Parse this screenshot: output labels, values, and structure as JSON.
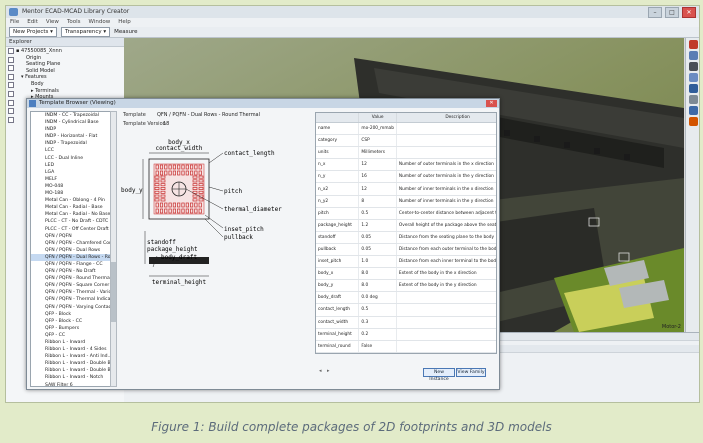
{
  "app": {
    "title": "Mentor ECAD-MCAD Library Creator",
    "menus": [
      "File",
      "Edit",
      "View",
      "Tools",
      "Window",
      "Help"
    ],
    "window_buttons": {
      "min": "–",
      "max": "□",
      "close": "✕"
    }
  },
  "toolbar": {
    "new_projects": "New Projects ▾",
    "transparency": "Transparency ▾",
    "measure": "Measure"
  },
  "explorer": {
    "header": "Explorer",
    "items": [
      {
        "label": "▪ 47550085_Xnnn",
        "indent": 0
      },
      {
        "label": "Origin",
        "indent": 2
      },
      {
        "label": "Seating Plane",
        "indent": 2
      },
      {
        "label": "Solid Model",
        "indent": 2
      },
      {
        "label": "▾ Features",
        "indent": 1
      },
      {
        "label": "Body",
        "indent": 3
      },
      {
        "label": "▸ Terminals",
        "indent": 3
      },
      {
        "label": "▸ Mounts",
        "indent": 3
      },
      {
        "label": "Other",
        "indent": 3
      }
    ]
  },
  "viewport": {
    "corner_label": "Motor-2"
  },
  "dialog": {
    "title": "Template Browser (Viewing)",
    "template_label": "Template",
    "template_value": "QFN / PQFN - Dual Rows - Round Thermal",
    "version_label": "Template Version",
    "version_value": "18",
    "list": [
      "INDM - CC - Trapezoidal",
      "INDM - Cylindrical Base",
      "INDP",
      "INDP - Horizontal - Flat",
      "INDP - Trapezoidal",
      "LCC",
      "LCC - Dual Inline",
      "LED",
      "LGA",
      "MELF",
      "MO-048",
      "MO-188",
      "Metal Can - Oblong - 4 Pin",
      "Metal Can - Radial - Base",
      "Metal Can - Radial - No Base",
      "PLCC - CT - No Draft - CDTC",
      "PLCC - CT - Off Center Draft",
      "QFN / PQFN",
      "QFN / PQFN - Chamfered Cor...",
      "QFN / PQFN - Dual Rows",
      "QFN / PQFN - Dual Rows - Ro...",
      "QFN / PQFN - Flange - CC",
      "QFN / PQFN - No Draft",
      "QFN / PQFN - Round Thermal",
      "QFN / PQFN - Square Corner T...",
      "QFN / PQFN - Thermal - Vario...",
      "QFN / PQFN - Thermal Indicator",
      "QFN / PQFN - Varying Contac...",
      "QFP - Block",
      "QFP - Block - CC",
      "QFP - Bumpers",
      "QFP - CC",
      "Ribbon L - Inward",
      "Ribbon L - Inward - 4 Sides",
      "Ribbon L - Inward - Anti Ind...",
      "Ribbon L - Inward - Double B...",
      "Ribbon L - Inward - Double B...",
      "Ribbon L - Inward - Notch",
      "SAW Filter 6",
      "SAW Filter8",
      "SIP",
      "SOD - Gullwing",
      "SODFL",
      "SOJ - CT",
      "SOJ - CT - Off Center Draft"
    ],
    "selected_index": 20,
    "diagram_labels": {
      "body_x": "body_x",
      "contact_width": "contact_width",
      "contact_length": "contact_length",
      "body_y": "body_y",
      "pitch": "pitch",
      "thermal_diameter": "thermal_diameter",
      "inset_pitch": "inset_pitch",
      "pullback": "pullback",
      "standoff": "standoff",
      "package_height": "package_height",
      "body_draft": "body_draft",
      "terminal_height": "terminal_height"
    },
    "table": {
      "headers": [
        "",
        "Value",
        "Description"
      ],
      "rows": [
        [
          "name",
          "mo-200_mmab",
          ""
        ],
        [
          "category",
          "CSP",
          ""
        ],
        [
          "units",
          "Millimeters",
          ""
        ],
        [
          "n_x",
          "12",
          "Number of outer terminals in the x direction"
        ],
        [
          "n_y",
          "16",
          "Number of outer terminals in the y direction"
        ],
        [
          "n_x2",
          "12",
          "Number of inner terminals in the x direction"
        ],
        [
          "n_y2",
          "8",
          "Number of inner terminals in the y direction"
        ],
        [
          "pitch",
          "0.5",
          "Center-to-center distance between adjacent terminals"
        ],
        [
          "package_height",
          "1.2",
          "Overall height of the package above the seating plane"
        ],
        [
          "standoff",
          "0.05",
          "Distance from the seating plane to the body"
        ],
        [
          "pullback",
          "0.05",
          "Distance from each outer terminal to the body edge"
        ],
        [
          "inset_pitch",
          "1.0",
          "Distance from each inner terminal to the body edge"
        ],
        [
          "body_x",
          "8.0",
          "Extent of the body in the x direction"
        ],
        [
          "body_y",
          "8.0",
          "Extent of the body in the y direction"
        ],
        [
          "body_draft",
          "0.0 deg",
          ""
        ],
        [
          "contact_length",
          "0.5",
          ""
        ],
        [
          "contact_width",
          "0.3",
          ""
        ],
        [
          "terminal_height",
          "0.2",
          ""
        ],
        [
          "terminal_round",
          "False",
          ""
        ],
        [
          "thermal_package",
          "True",
          ""
        ],
        [
          "thermal_diameter",
          "2.0",
          ""
        ]
      ]
    },
    "buttons": {
      "new_instance": "New Instance",
      "view_family": "View Family"
    }
  },
  "caption": "Figure 1: Build complete packages of 2D footprints and 3D models"
}
